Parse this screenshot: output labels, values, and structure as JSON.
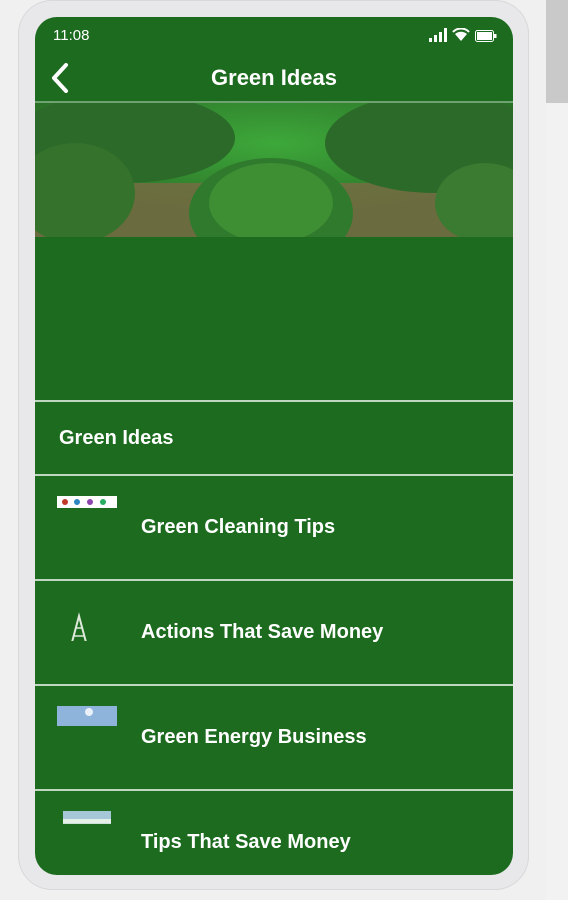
{
  "status_bar": {
    "time": "11:08",
    "icons": [
      "signal-icon",
      "wifi-icon",
      "battery-icon"
    ]
  },
  "app_bar": {
    "title": "Green Ideas",
    "back_icon": "back-chevron-icon"
  },
  "colors": {
    "primary_green": "#1c6b1f",
    "divider": "#bfd6c0",
    "text": "#ffffff"
  },
  "list": {
    "section_title": "Green Ideas",
    "items": [
      {
        "label": "Green Cleaning Tips",
        "thumbnail": "cleaning-thumbnail"
      },
      {
        "label": "Actions That Save Money",
        "thumbnail": "tower-thumbnail"
      },
      {
        "label": "Green Energy Business",
        "thumbnail": "sky-thumbnail"
      },
      {
        "label": "Tips That Save Money",
        "thumbnail": "sky-thumbnail"
      }
    ]
  }
}
